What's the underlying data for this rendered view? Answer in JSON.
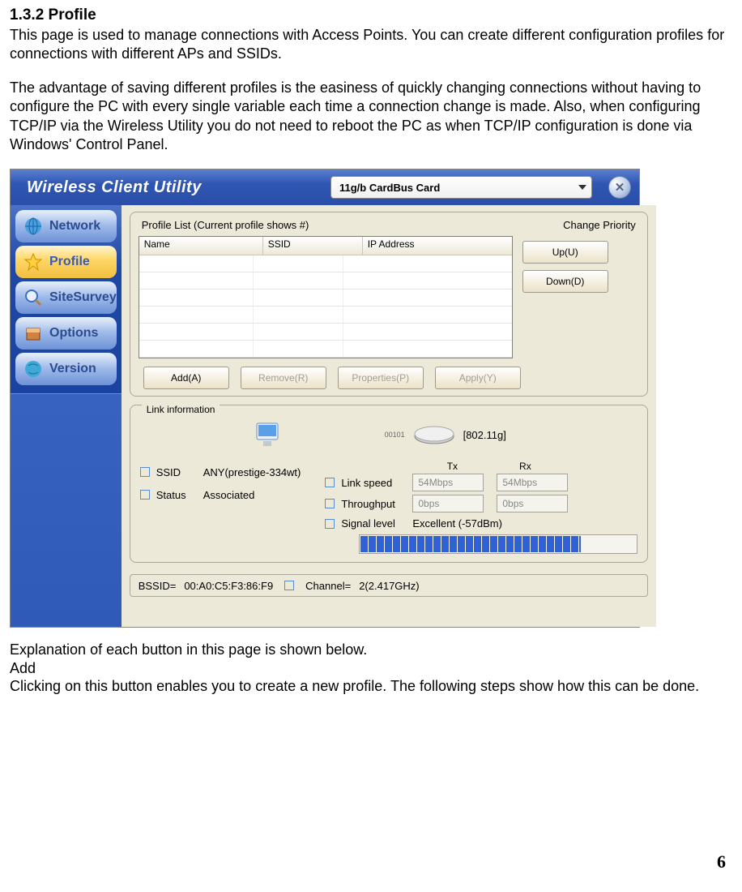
{
  "doc": {
    "section_number": "1.3.2",
    "section_title": "Profile",
    "para1": "This page is used to manage connections with Access Points. You can create different configuration profiles for connections with different APs and SSIDs.",
    "para2": "The advantage of saving different profiles is the easiness of quickly changing connections without having to configure the PC with every single variable each time a connection change is made. Also, when configuring TCP/IP via the Wireless Utility you do not need to reboot the PC as when TCP/IP configuration is done via Windows' Control Panel.",
    "explain_heading": "Explanation of each button in this page is shown below.",
    "add_label": "Add",
    "add_desc": "Clicking on this button enables you to create a new profile. The following steps show how this can be done.",
    "page_number": "6"
  },
  "app": {
    "title": "Wireless Client Utility",
    "device_selected": "11g/b CardBus Card",
    "nav": {
      "network": "Network",
      "profile": "Profile",
      "sitesurvey": "SiteSurvey",
      "options": "Options",
      "version": "Version"
    },
    "profile_panel": {
      "list_label": "Profile List (Current profile shows #)",
      "change_priority": "Change Priority",
      "cols": {
        "name": "Name",
        "ssid": "SSID",
        "ip": "IP Address"
      },
      "buttons": {
        "up": "Up(U)",
        "down": "Down(D)",
        "add": "Add(A)",
        "remove": "Remove(R)",
        "properties": "Properties(P)",
        "apply": "Apply(Y)"
      }
    },
    "link": {
      "legend": "Link information",
      "binary_label": "00101",
      "mode": "[802.11g]",
      "ssid_label": "SSID",
      "ssid_value": "ANY(prestige-334wt)",
      "status_label": "Status",
      "status_value": "Associated",
      "tx": "Tx",
      "rx": "Rx",
      "linkspeed_label": "Link speed",
      "linkspeed_tx": "54Mbps",
      "linkspeed_rx": "54Mbps",
      "throughput_label": "Throughput",
      "throughput_tx": "0bps",
      "throughput_rx": "0bps",
      "signal_label": "Signal level",
      "signal_value": "Excellent (-57dBm)"
    },
    "status_bar": {
      "bssid_prefix": "BSSID=",
      "bssid": "00:A0:C5:F3:86:F9",
      "channel_prefix": "Channel=",
      "channel": "2(2.417GHz)"
    }
  }
}
